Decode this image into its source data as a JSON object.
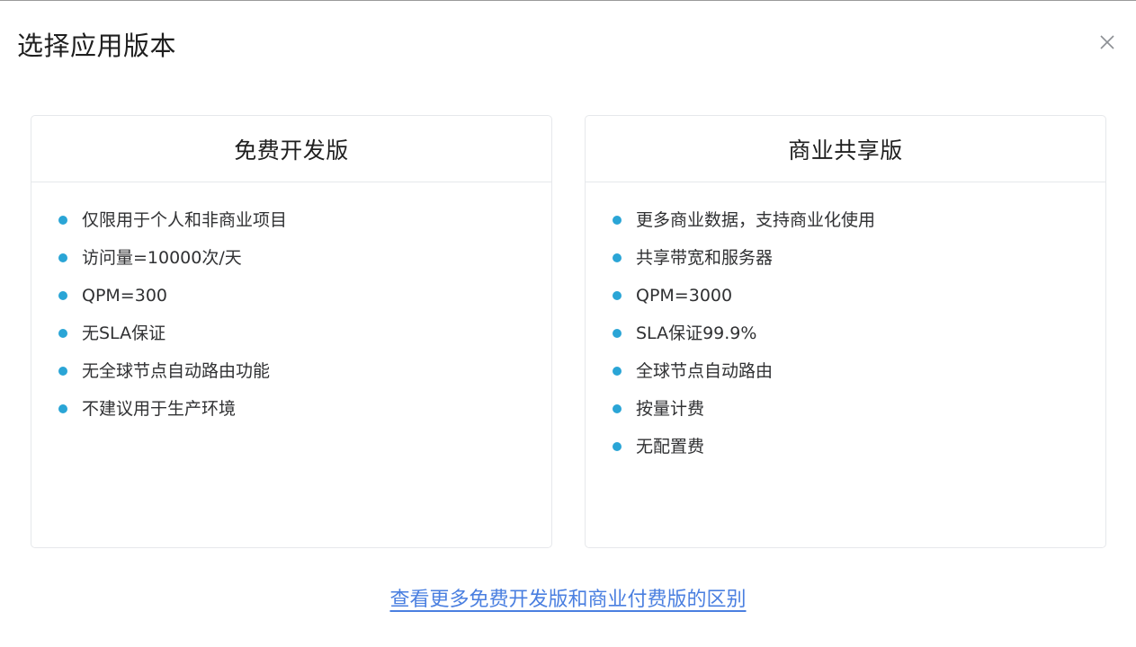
{
  "dialog": {
    "title": "选择应用版本"
  },
  "plans": [
    {
      "title": "免费开发版",
      "features": [
        "仅限用于个人和非商业项目",
        "访问量=10000次/天",
        "QPM=300",
        "无SLA保证",
        "无全球节点自动路由功能",
        "不建议用于生产环境"
      ]
    },
    {
      "title": "商业共享版",
      "features": [
        "更多商业数据，支持商业化使用",
        "共享带宽和服务器",
        "QPM=3000",
        "SLA保证99.9%",
        "全球节点自动路由",
        "按量计费",
        "无配置费"
      ]
    }
  ],
  "footer": {
    "compare_link": "查看更多免费开发版和商业付费版的区别"
  },
  "colors": {
    "bullet": "#2aa5d6",
    "link": "#4a7fe0",
    "border": "#e6e8eb"
  },
  "icons": {
    "close": "close-icon",
    "bullet": "bullet-dot"
  }
}
